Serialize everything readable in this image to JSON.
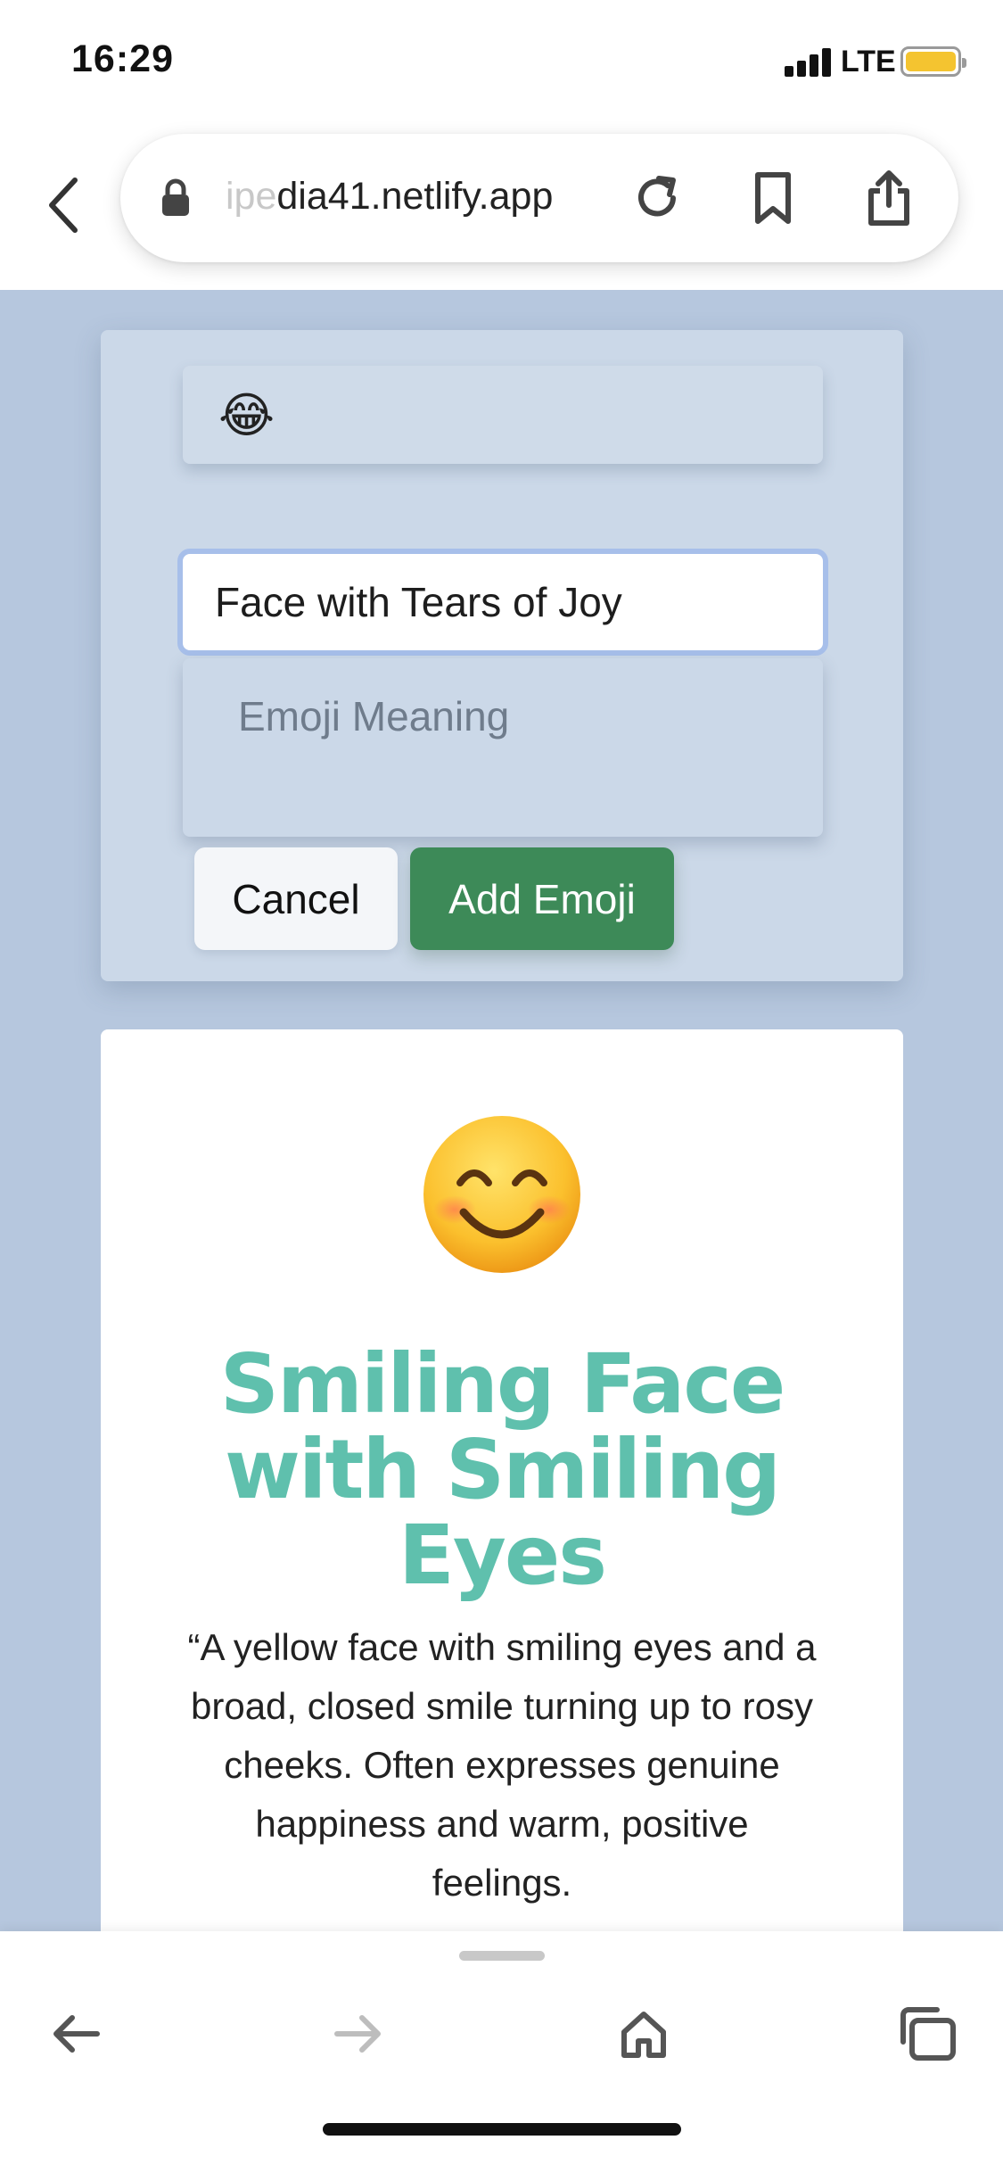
{
  "status_bar": {
    "time": "16:29",
    "network": "LTE",
    "battery_level": 1.0,
    "battery_color": "#f4c430"
  },
  "browser": {
    "back_icon": "chevron-left-icon",
    "url_faded": "ipe",
    "url_main": "dia41.netlify.app",
    "lock_icon": "lock-icon",
    "reload_icon": "reload-icon",
    "bookmark_icon": "bookmark-icon",
    "share_icon": "share-icon"
  },
  "form": {
    "emoji_value": "😂",
    "name_value": "Face with Tears of Joy",
    "meaning_placeholder": "Emoji Meaning",
    "cancel_label": "Cancel",
    "add_label": "Add Emoji",
    "accent_color": "#3d8a58"
  },
  "emoji_card": {
    "emoji_icon": "smiling-face-emoji",
    "title": "Smiling Face with Smiling Eyes",
    "description": "“A yellow face with smiling eyes and a broad, closed smile turning up to rosy cheeks. Often expresses genuine happiness and warm, positive feelings.",
    "title_color": "#5fc0ad"
  },
  "toolbar": {
    "back_icon": "arrow-left-icon",
    "forward_icon": "arrow-right-icon",
    "home_icon": "home-icon",
    "tabs_icon": "tabs-icon"
  }
}
